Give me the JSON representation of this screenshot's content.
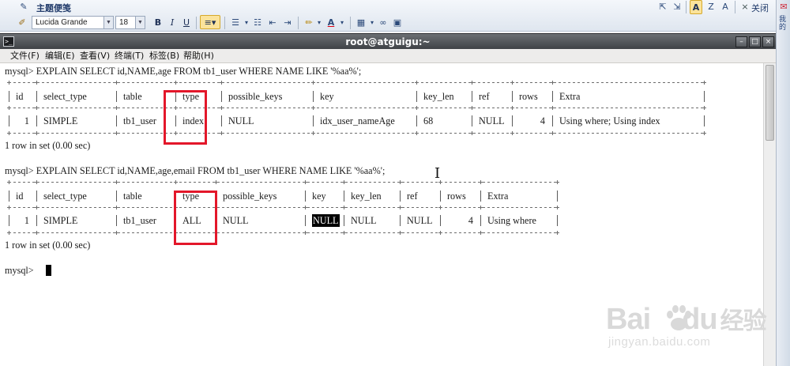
{
  "editor_toolbar": {
    "title": "主题便笺",
    "font_name": "Lucida Grande",
    "font_size": "18",
    "bold": "B",
    "italic": "I",
    "underline": "U",
    "close_label": "关闭"
  },
  "side_panel": {
    "text": "我的"
  },
  "terminal": {
    "title": "root@atguigu:~",
    "menu": [
      "文件(F)",
      "编辑(E)",
      "查看(V)",
      "终端(T)",
      "标签(B)",
      "帮助(H)"
    ],
    "query1": {
      "command": "mysql> EXPLAIN SELECT id,NAME,age FROM tb1_user WHERE NAME LIKE '%aa%';",
      "headers": [
        "id",
        "select_type",
        "table",
        "type",
        "possible_keys",
        "key",
        "key_len",
        "ref",
        "rows",
        "Extra"
      ],
      "row": [
        "1",
        "SIMPLE",
        "tb1_user",
        "index",
        "NULL",
        "idx_user_nameAge",
        "68",
        "NULL",
        "4",
        "Using where; Using index"
      ],
      "result": "1 row in set (0.00 sec)"
    },
    "query2": {
      "command": "mysql> EXPLAIN SELECT id,NAME,age,email FROM tb1_user WHERE NAME LIKE '%aa%';",
      "headers": [
        "id",
        "select_type",
        "table",
        "type",
        "possible_keys",
        "key",
        "key_len",
        "ref",
        "rows",
        "Extra"
      ],
      "row": [
        "1",
        "SIMPLE",
        "tb1_user",
        "ALL",
        "NULL",
        "NULL",
        "NULL",
        "NULL",
        "4",
        "Using where"
      ],
      "result": "1 row in set (0.00 sec)"
    },
    "prompt": "mysql>"
  },
  "watermark": {
    "logo_left": "Bai",
    "logo_right": "du",
    "logo_cn": "经验",
    "sub": "jingyan.baidu.com"
  },
  "colors": {
    "annotation": "#e3172a",
    "titlebar": "#4b4f53",
    "selection": "#000000"
  }
}
